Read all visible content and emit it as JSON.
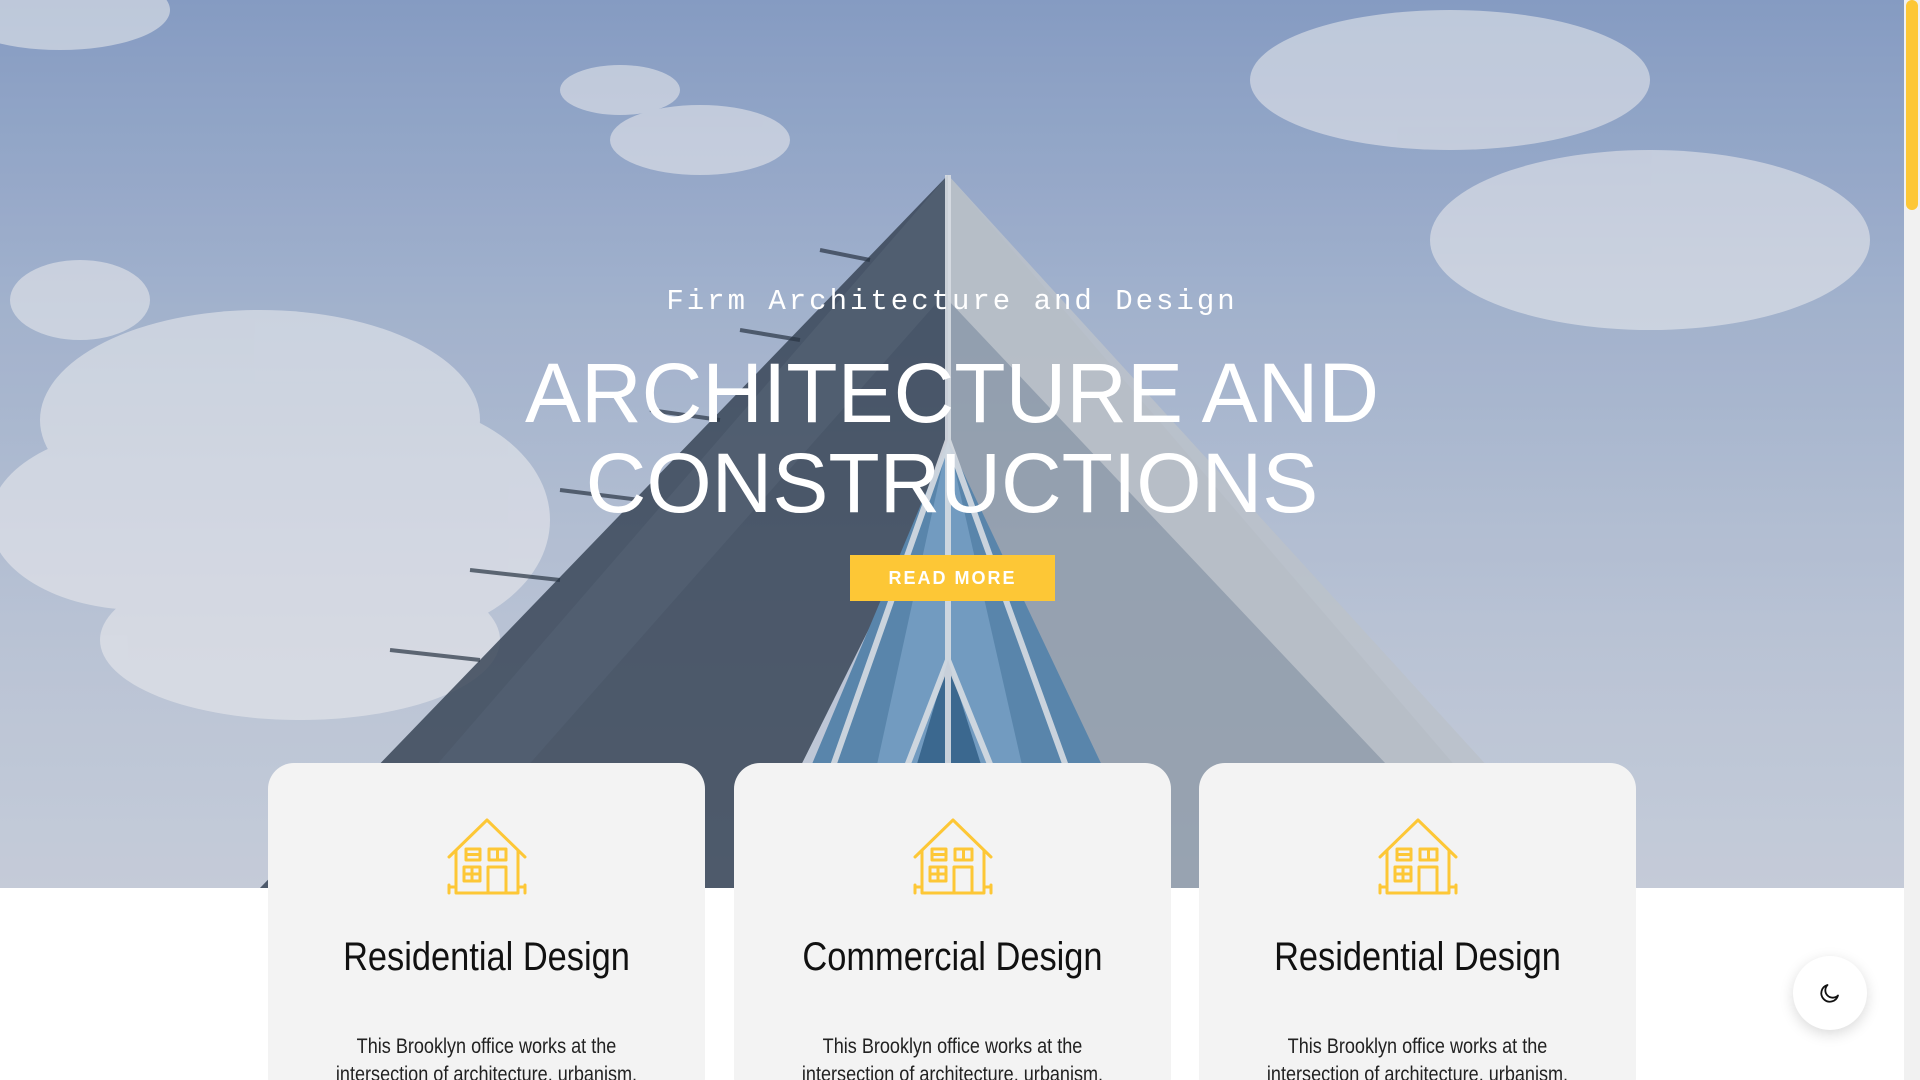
{
  "hero": {
    "subtitle": "Firm Architecture and Design",
    "title_line1": "ARCHITECTURE AND",
    "title_line2": "CONSTRUCTIONS",
    "button_label": "READ MORE"
  },
  "cards": [
    {
      "icon": "house-icon",
      "title": "Residential Design",
      "text": "This Brooklyn office works at the intersection of architecture, urbanism, and art... and really likes"
    },
    {
      "icon": "house-icon",
      "title": "Commercial Design",
      "text": "This Brooklyn office works at the intersection of architecture, urbanism, and art... and really likes"
    },
    {
      "icon": "house-icon",
      "title": "Residential Design",
      "text": "This Brooklyn office works at the intersection of architecture, urbanism, and art... and really likes"
    }
  ],
  "theme_toggle": {
    "icon": "moon-icon"
  },
  "colors": {
    "accent": "#fdc736",
    "card_background": "#f3f3f3",
    "text_dark": "#111111"
  }
}
